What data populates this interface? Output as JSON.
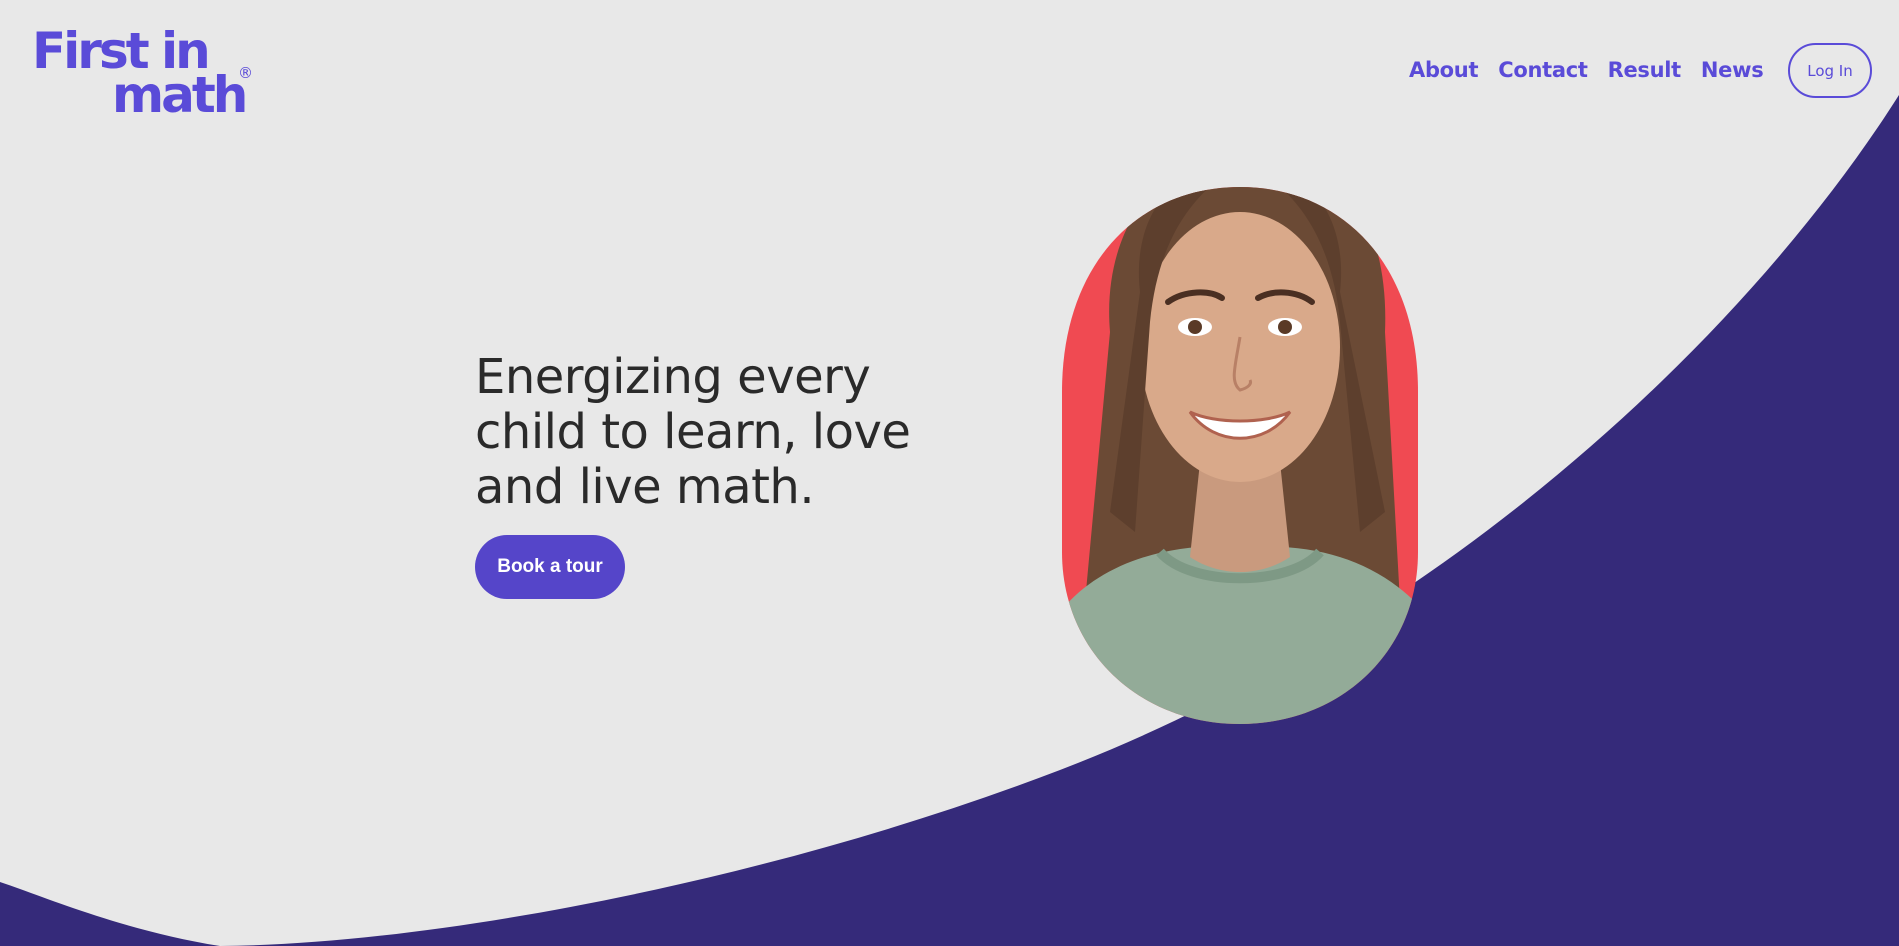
{
  "brand": {
    "logo_line1": "First in",
    "logo_line2": "math",
    "logo_reg": "®"
  },
  "nav": {
    "items": [
      {
        "label": "About"
      },
      {
        "label": "Contact"
      },
      {
        "label": "Result"
      },
      {
        "label": "News"
      }
    ],
    "login_label": "Log In"
  },
  "hero": {
    "headline": "Energizing every child to learn, love and live math.",
    "cta_label": "Book a tour"
  },
  "colors": {
    "accent": "#5a4bd8",
    "button": "#5545c9",
    "wave": "#352a7a",
    "background": "#e8e8e8",
    "portrait_backdrop": "#f04a52"
  },
  "icons": {
    "portrait": "child-portrait-image"
  }
}
